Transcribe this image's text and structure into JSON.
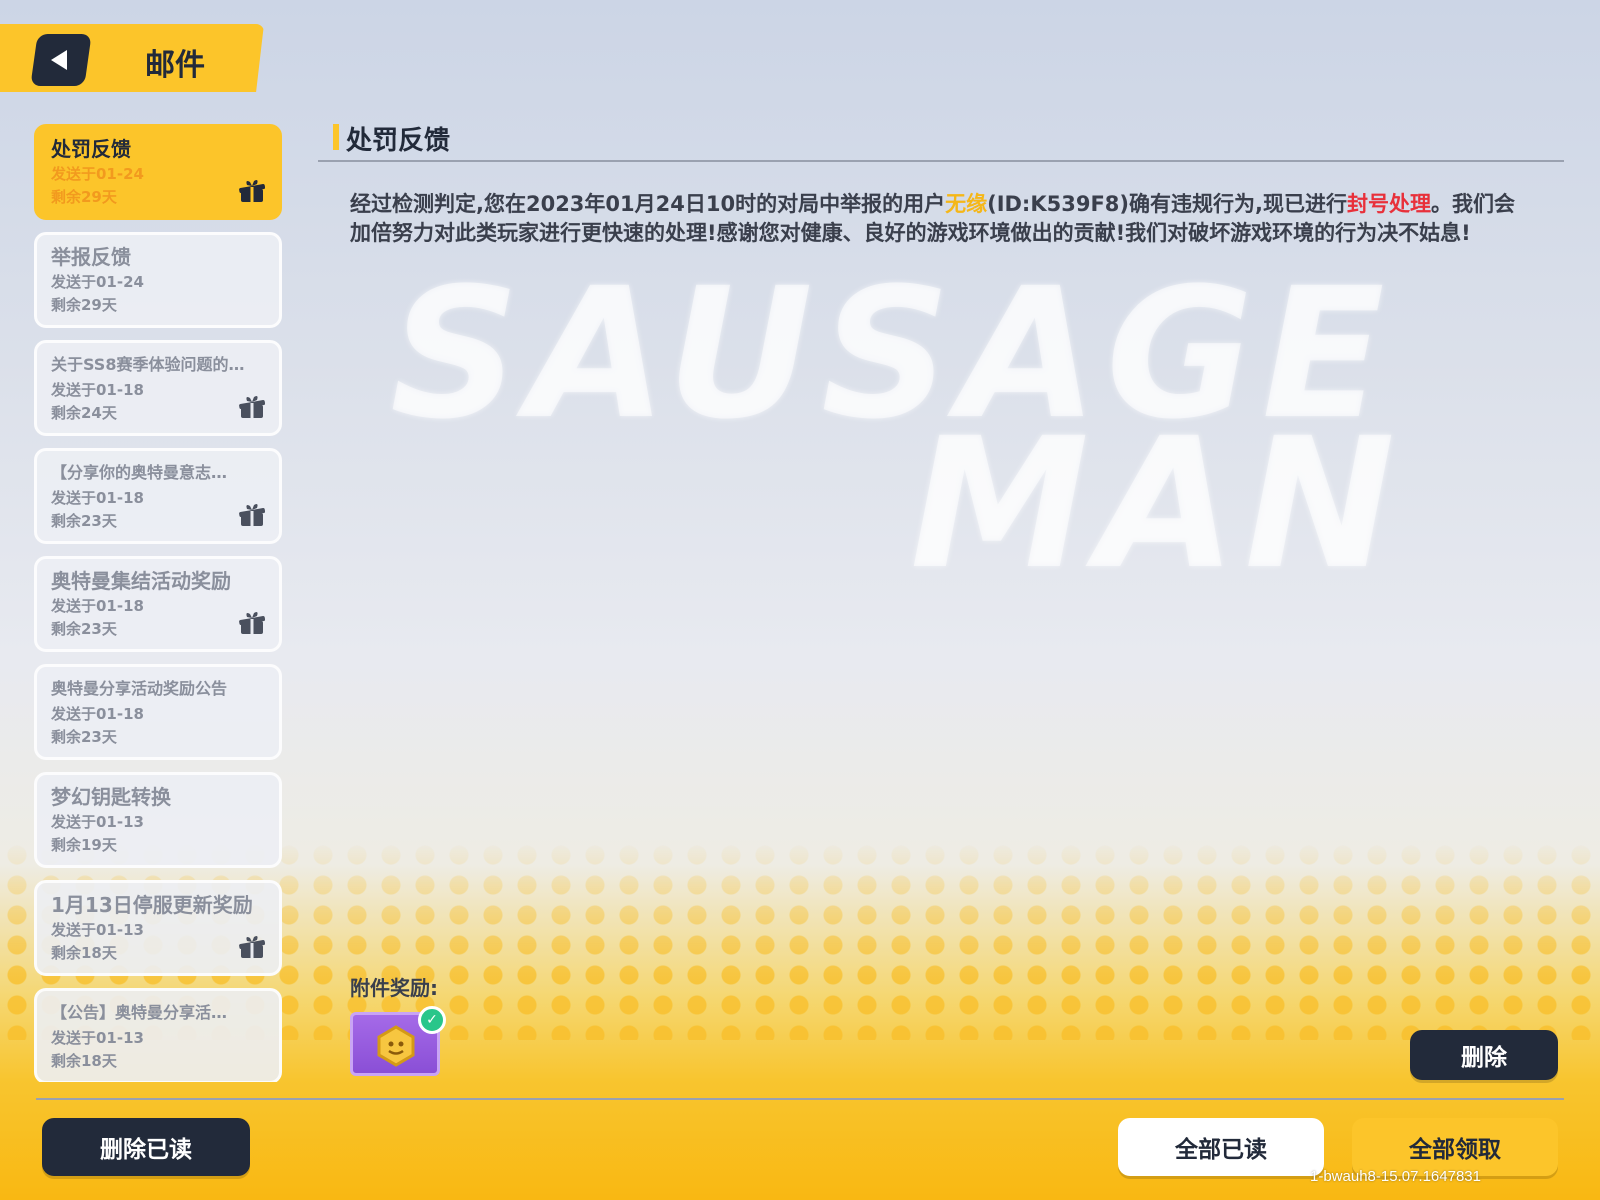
{
  "header": {
    "title": "邮件"
  },
  "mail_list": [
    {
      "title": "处罚反馈",
      "sent": "发送于01-24",
      "remaining": "剩余29天",
      "has_gift": true,
      "selected": true,
      "small": false
    },
    {
      "title": "举报反馈",
      "sent": "发送于01-24",
      "remaining": "剩余29天",
      "has_gift": false,
      "selected": false,
      "small": false
    },
    {
      "title": "关于SS8赛季体验问题的…",
      "sent": "发送于01-18",
      "remaining": "剩余24天",
      "has_gift": true,
      "selected": false,
      "small": true
    },
    {
      "title": "【分享你的奥特曼意志…",
      "sent": "发送于01-18",
      "remaining": "剩余23天",
      "has_gift": true,
      "selected": false,
      "small": true
    },
    {
      "title": "奥特曼集结活动奖励",
      "sent": "发送于01-18",
      "remaining": "剩余23天",
      "has_gift": true,
      "selected": false,
      "small": false
    },
    {
      "title": "奥特曼分享活动奖励公告",
      "sent": "发送于01-18",
      "remaining": "剩余23天",
      "has_gift": false,
      "selected": false,
      "small": true
    },
    {
      "title": "梦幻钥匙转换",
      "sent": "发送于01-13",
      "remaining": "剩余19天",
      "has_gift": false,
      "selected": false,
      "small": false
    },
    {
      "title": "1月13日停服更新奖励",
      "sent": "发送于01-13",
      "remaining": "剩余18天",
      "has_gift": true,
      "selected": false,
      "small": false
    },
    {
      "title": "【公告】奥特曼分享活…",
      "sent": "发送于01-13",
      "remaining": "剩余18天",
      "has_gift": false,
      "selected": false,
      "small": true
    }
  ],
  "content": {
    "title": "处罚反馈",
    "body_part1": "经过检测判定,您在2023年01月24日10时的对局中举报的用户",
    "body_name": "无缘",
    "body_part2": "(ID:K539F8)确有违规行为,现已进行",
    "body_action": "封号处理",
    "body_part3": "。我们会加倍努力对此类玩家进行更快速的处理!感谢您对健康、良好的游戏环境做出的贡献!我们对破坏游戏环境的行为决不姑息!",
    "attachment_label": "附件奖励:",
    "watermark_line1": "SAUSAGE",
    "watermark_line2": "MAN"
  },
  "buttons": {
    "delete": "删除",
    "delete_read": "删除已读",
    "read_all": "全部已读",
    "claim_all": "全部领取"
  },
  "version": "1-bwauh8-15.07.1647831",
  "colors": {
    "accent": "#fcc52a",
    "dark": "#222a3a",
    "highlight_name": "#f5b718",
    "highlight_action": "#e8303a"
  },
  "icons": {
    "back": "back-arrow-icon",
    "gift": "gift-icon",
    "reward": "coin-icon",
    "claimed": "check-icon"
  }
}
